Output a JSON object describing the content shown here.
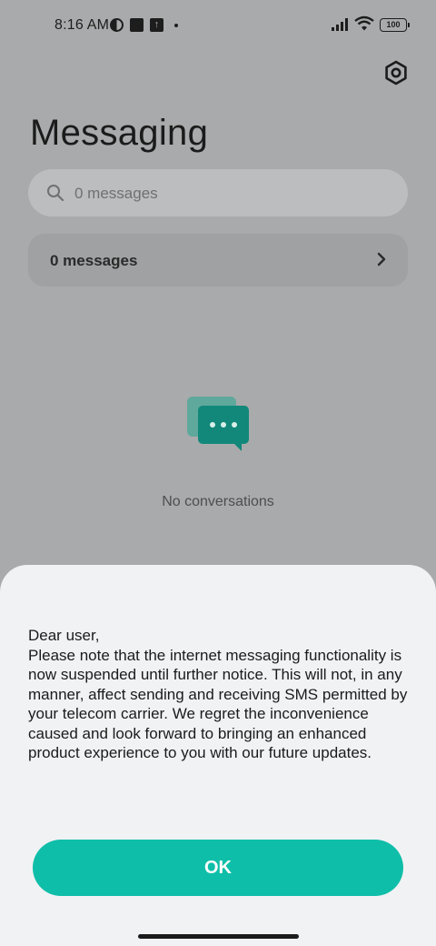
{
  "status_bar": {
    "time": "8:16 AM",
    "battery": "100",
    "icons": [
      "half-circle-icon",
      "square-icon",
      "upload-icon",
      "dot-icon",
      "signal-icon",
      "wifi-icon",
      "battery-icon"
    ]
  },
  "header": {
    "title": "Messaging",
    "settings_icon": "gear-icon"
  },
  "search": {
    "placeholder": "0 messages",
    "icon": "search-icon"
  },
  "messages_row": {
    "label": "0 messages",
    "icon": "chevron-right-icon"
  },
  "empty_state": {
    "icon": "chat-bubbles-icon",
    "text": "No conversations"
  },
  "dialog": {
    "greeting": "Dear user,",
    "body": "Please note that the internet messaging functionality is now suspended until further notice. This will not, in any manner, affect sending and receiving SMS permitted by your telecom carrier. We regret the inconvenience caused and look forward to bringing an enhanced product experience to you with our future updates.",
    "ok_label": "OK"
  },
  "colors": {
    "accent": "#0fbea8",
    "scrim_background": "#a9aaab",
    "sheet_background": "#f1f2f4"
  }
}
